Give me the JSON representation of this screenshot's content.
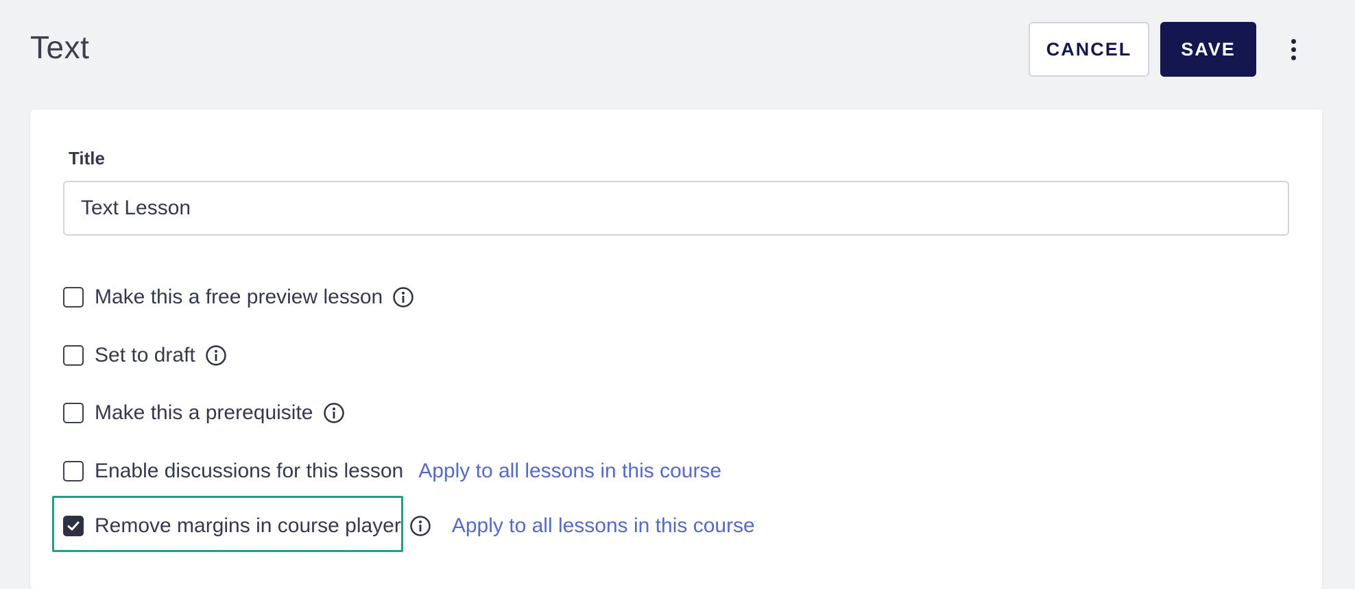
{
  "header": {
    "title": "Text",
    "cancel_label": "CANCEL",
    "save_label": "SAVE"
  },
  "form": {
    "title_label": "Title",
    "title_value": "Text Lesson",
    "options": [
      {
        "label": "Make this a free preview lesson",
        "checked": false
      },
      {
        "label": "Set to draft",
        "checked": false
      },
      {
        "label": "Make this a prerequisite",
        "checked": false
      },
      {
        "label": "Enable discussions for this lesson",
        "checked": false,
        "link": "Apply to all lessons in this course"
      },
      {
        "label": "Remove margins in course player",
        "checked": true,
        "link": "Apply to all lessons in this course"
      }
    ]
  },
  "colors": {
    "primary": "#141650",
    "link": "#5469c8",
    "highlight": "#1f9e88",
    "background": "#f1f2f4"
  }
}
